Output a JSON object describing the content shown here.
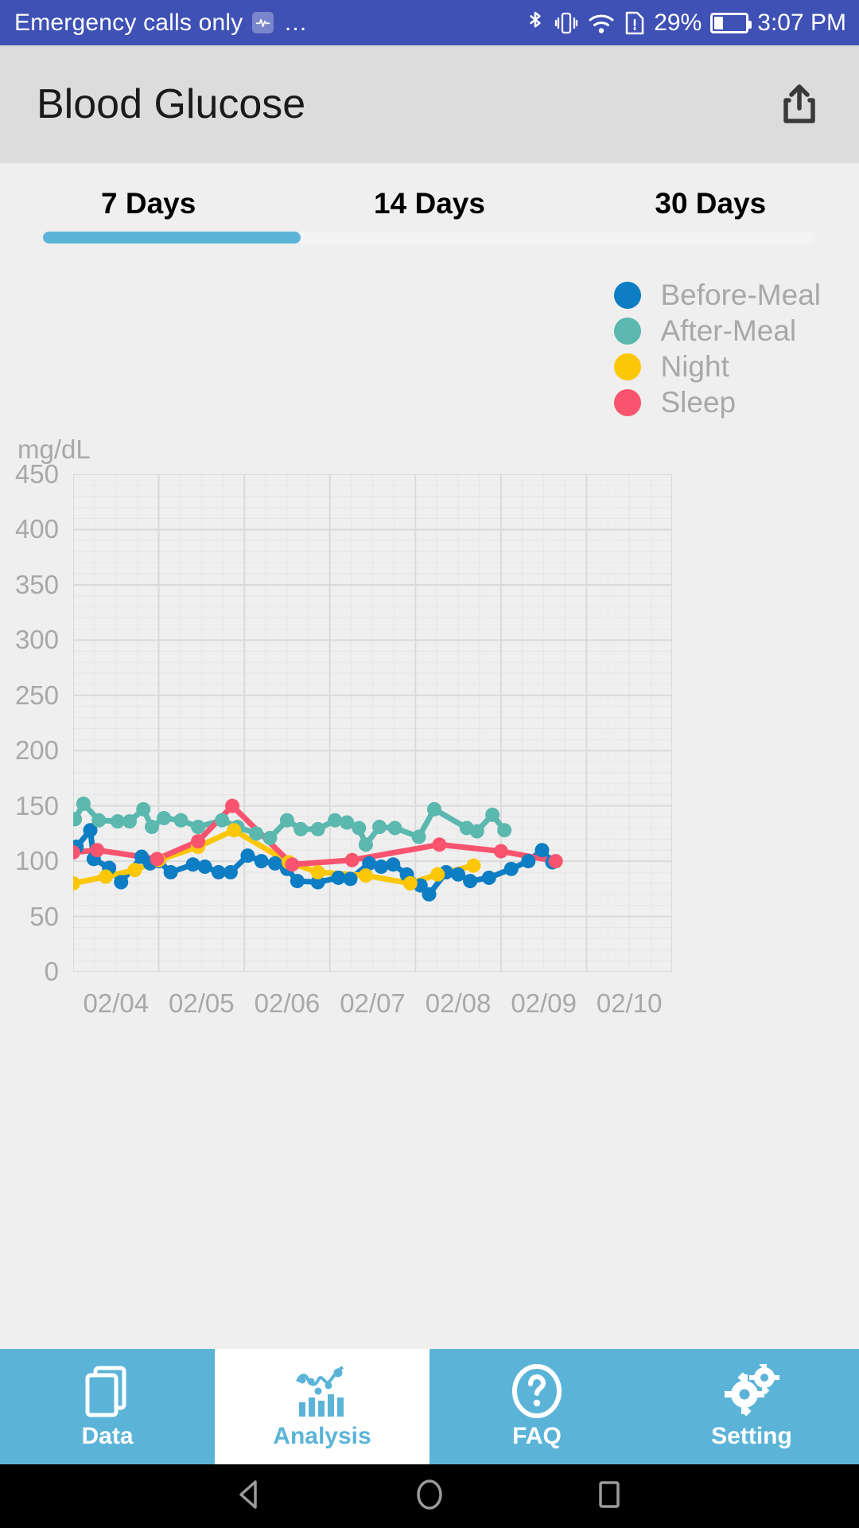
{
  "statusbar": {
    "carrier": "Emergency calls only",
    "heart_icon": "heart-rate-icon",
    "overflow": "…",
    "bluetooth_icon": "bluetooth-icon",
    "vibrate_icon": "vibrate-icon",
    "wifi_icon": "wifi-icon",
    "sim_icon": "sim-card-icon",
    "battery_percent": "29%",
    "battery_icon": "battery-icon",
    "time": "3:07 PM"
  },
  "header": {
    "title": "Blood Glucose",
    "share_icon": "share-icon"
  },
  "tabs": {
    "items": [
      {
        "label": "7 Days",
        "active": true
      },
      {
        "label": "14 Days",
        "active": false
      },
      {
        "label": "30 Days",
        "active": false
      }
    ],
    "active_index": 0,
    "accent": "#5bb4d8"
  },
  "legend": {
    "items": [
      {
        "label": "Before-Meal",
        "color": "#0d7dc4"
      },
      {
        "label": "After-Meal",
        "color": "#5bb8ae"
      },
      {
        "label": "Night",
        "color": "#fbc707"
      },
      {
        "label": "Sleep",
        "color": "#f9546f"
      }
    ]
  },
  "chart_data": {
    "type": "line",
    "title": "Blood Glucose",
    "unit_label": "mg/dL",
    "xlabel": "",
    "ylabel": "mg/dL",
    "ylim": [
      0,
      450
    ],
    "yticks": [
      0,
      50,
      100,
      150,
      200,
      250,
      300,
      350,
      400,
      450
    ],
    "grid": true,
    "legend_position": "top-right",
    "categories": [
      "02/04",
      "02/05",
      "02/06",
      "02/07",
      "02/08",
      "02/09",
      "02/10"
    ],
    "xlim": [
      0,
      7
    ],
    "series": [
      {
        "name": "Before-Meal",
        "color": "#0d7dc4",
        "points": [
          {
            "x": 0.04,
            "y": 113
          },
          {
            "x": 0.2,
            "y": 128
          },
          {
            "x": 0.24,
            "y": 102
          },
          {
            "x": 0.42,
            "y": 94
          },
          {
            "x": 0.56,
            "y": 81
          },
          {
            "x": 0.8,
            "y": 104
          },
          {
            "x": 0.9,
            "y": 98
          },
          {
            "x": 1.0,
            "y": 100
          },
          {
            "x": 1.14,
            "y": 90
          },
          {
            "x": 1.4,
            "y": 97
          },
          {
            "x": 1.54,
            "y": 95
          },
          {
            "x": 1.7,
            "y": 90
          },
          {
            "x": 1.84,
            "y": 90
          },
          {
            "x": 2.04,
            "y": 105
          },
          {
            "x": 2.2,
            "y": 100
          },
          {
            "x": 2.36,
            "y": 98
          },
          {
            "x": 2.5,
            "y": 93
          },
          {
            "x": 2.62,
            "y": 82
          },
          {
            "x": 2.86,
            "y": 81
          },
          {
            "x": 3.1,
            "y": 85
          },
          {
            "x": 3.24,
            "y": 84
          },
          {
            "x": 3.46,
            "y": 98
          },
          {
            "x": 3.6,
            "y": 95
          },
          {
            "x": 3.74,
            "y": 97
          },
          {
            "x": 3.9,
            "y": 88
          },
          {
            "x": 4.06,
            "y": 78
          },
          {
            "x": 4.16,
            "y": 70
          },
          {
            "x": 4.36,
            "y": 90
          },
          {
            "x": 4.5,
            "y": 88
          },
          {
            "x": 4.64,
            "y": 82
          },
          {
            "x": 4.86,
            "y": 85
          },
          {
            "x": 5.12,
            "y": 93
          },
          {
            "x": 5.32,
            "y": 100
          },
          {
            "x": 5.48,
            "y": 110
          },
          {
            "x": 5.6,
            "y": 99
          }
        ]
      },
      {
        "name": "After-Meal",
        "color": "#5bb8ae",
        "points": [
          {
            "x": 0.02,
            "y": 138
          },
          {
            "x": 0.12,
            "y": 152
          },
          {
            "x": 0.3,
            "y": 137
          },
          {
            "x": 0.52,
            "y": 136
          },
          {
            "x": 0.66,
            "y": 136
          },
          {
            "x": 0.82,
            "y": 147
          },
          {
            "x": 0.92,
            "y": 131
          },
          {
            "x": 1.06,
            "y": 139
          },
          {
            "x": 1.26,
            "y": 137
          },
          {
            "x": 1.46,
            "y": 131
          },
          {
            "x": 1.74,
            "y": 137
          },
          {
            "x": 1.92,
            "y": 131
          },
          {
            "x": 2.14,
            "y": 125
          },
          {
            "x": 2.3,
            "y": 121
          },
          {
            "x": 2.5,
            "y": 137
          },
          {
            "x": 2.66,
            "y": 129
          },
          {
            "x": 2.86,
            "y": 129
          },
          {
            "x": 3.06,
            "y": 137
          },
          {
            "x": 3.2,
            "y": 135
          },
          {
            "x": 3.34,
            "y": 130
          },
          {
            "x": 3.42,
            "y": 115
          },
          {
            "x": 3.58,
            "y": 131
          },
          {
            "x": 3.76,
            "y": 130
          },
          {
            "x": 4.04,
            "y": 122
          },
          {
            "x": 4.22,
            "y": 147
          },
          {
            "x": 4.6,
            "y": 130
          },
          {
            "x": 4.72,
            "y": 127
          },
          {
            "x": 4.9,
            "y": 142
          },
          {
            "x": 5.04,
            "y": 128
          }
        ]
      },
      {
        "name": "Night",
        "color": "#fbc707",
        "points": [
          {
            "x": 0.0,
            "y": 80
          },
          {
            "x": 0.38,
            "y": 86
          },
          {
            "x": 0.72,
            "y": 92
          },
          {
            "x": 1.0,
            "y": 101
          },
          {
            "x": 1.46,
            "y": 113
          },
          {
            "x": 1.88,
            "y": 128
          },
          {
            "x": 2.52,
            "y": 99
          },
          {
            "x": 2.86,
            "y": 90
          },
          {
            "x": 3.42,
            "y": 87
          },
          {
            "x": 3.94,
            "y": 80
          },
          {
            "x": 4.26,
            "y": 88
          },
          {
            "x": 4.68,
            "y": 96
          }
        ]
      },
      {
        "name": "Sleep",
        "color": "#f9546f",
        "points": [
          {
            "x": 0.0,
            "y": 108
          },
          {
            "x": 0.28,
            "y": 110
          },
          {
            "x": 0.98,
            "y": 102
          },
          {
            "x": 1.46,
            "y": 118
          },
          {
            "x": 1.86,
            "y": 150
          },
          {
            "x": 2.56,
            "y": 97
          },
          {
            "x": 3.26,
            "y": 101
          },
          {
            "x": 4.28,
            "y": 115
          },
          {
            "x": 5.0,
            "y": 109
          },
          {
            "x": 5.64,
            "y": 100
          }
        ]
      }
    ]
  },
  "bottomnav": {
    "items": [
      {
        "label": "Data",
        "icon": "documents-icon",
        "active": false
      },
      {
        "label": "Analysis",
        "icon": "chart-icon",
        "active": true
      },
      {
        "label": "FAQ",
        "icon": "question-icon",
        "active": false
      },
      {
        "label": "Setting",
        "icon": "gears-icon",
        "active": false
      }
    ],
    "background": "#5bb4d8",
    "active_text_color": "#5bb4d8"
  },
  "androidnav": {
    "back_icon": "back-triangle-icon",
    "home_icon": "home-circle-icon",
    "recents_icon": "recents-square-icon"
  }
}
